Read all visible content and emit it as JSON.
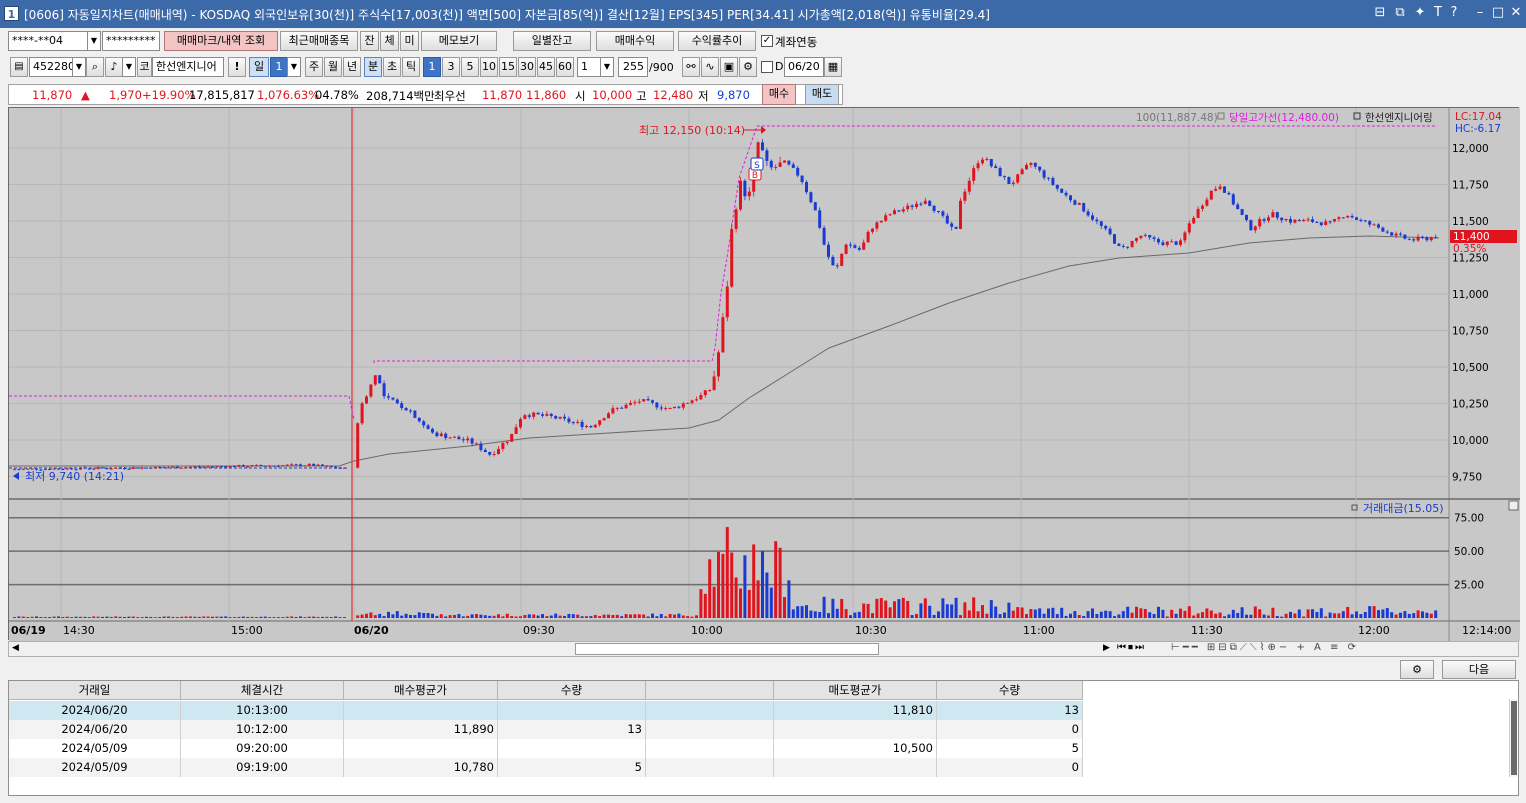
{
  "window": {
    "number": "1",
    "title": "[0606] 자동일지차트(매매내역) - KOSDAQ 외국인보유[30(천)] 주식수[17,003(천)] 액면[500] 자본금[85(억)] 결산[12월] EPS[345] PER[34.41] 시가총액[2,018(억)] 유통비율[29.4]"
  },
  "toolbar1": {
    "account": "****-**04",
    "password": "*********",
    "btn_mark": "매매마크/내역 조회",
    "btn_recent": "최근매매종목",
    "btn_jan": "잔",
    "btn_che": "체",
    "btn_mi": "미",
    "btn_memo": "메모보기",
    "btn_daily": "일별잔고",
    "btn_profit": "매매수익",
    "btn_trend": "수익률추이",
    "link_label": "계좌연동"
  },
  "toolbar2": {
    "code": "452280",
    "market_tag": "코",
    "stock_name": "한선엔지니어",
    "excl": "!",
    "period_day": "일",
    "period_num": "1",
    "week": "주",
    "month": "월",
    "year": "년",
    "min": "분",
    "sec": "초",
    "tick": "틱",
    "intervals": [
      "1",
      "3",
      "5",
      "10",
      "15",
      "30",
      "45",
      "60"
    ],
    "interval_value": "1",
    "count": "255",
    "count_total": "/900",
    "d_label": "D",
    "date": "06/20"
  },
  "quote": {
    "price": "11,870",
    "arrow": "▲",
    "change": "1,970",
    "rate": "+19.90%",
    "volume": "17,815,817",
    "vol_rate": "1,076.63%",
    "turnover": "04.78%",
    "amount": "208,714백만",
    "hoga_label": "최우선",
    "ask": "11,870",
    "bid": "11,860",
    "open_label": "시",
    "open": "10,000",
    "high_label": "고",
    "high": "12,480",
    "low_label": "저",
    "low": "9,870",
    "buy": "매수",
    "sell": "매도"
  },
  "chart": {
    "legend_ma": "100(11,887.48)",
    "legend_upper": "당일고가선(12,480.00)",
    "legend_name": "한선엔지니어링",
    "lc": "LC:17.04",
    "hc": "HC:-6.17",
    "high_note": "최고 12,150 (10:14)",
    "low_note": "최저 9,740 (14:21)",
    "price_tag": "11,400",
    "rate_tag": "0.35%",
    "y_ticks": [
      "12,000",
      "11,750",
      "11,500",
      "11,250",
      "11,000",
      "10,750",
      "10,500",
      "10,250",
      "10,000",
      "9,750"
    ],
    "vol_legend": "거래대금(15.05)",
    "vol_ticks": [
      "75.00",
      "50.00",
      "25.00"
    ],
    "x_labels": [
      "06/19",
      "14:30",
      "15:00",
      "06/20",
      "09:30",
      "10:00",
      "10:30",
      "11:00",
      "11:30",
      "12:00"
    ],
    "x_end": "12:14:00",
    "buy_mark": "B",
    "sell_mark": "S"
  },
  "chart_data": {
    "type": "candlestick",
    "y_range": [
      9700,
      12250
    ],
    "volume_range": [
      0,
      80
    ],
    "ma_label": "100",
    "high_line": 12480,
    "prev_upper_line": 10300
  },
  "bottom": {
    "next_btn": "다음"
  },
  "table": {
    "headers": [
      "거래일",
      "체결시간",
      "매수평균가",
      "수량",
      "",
      "매도평균가",
      "수량"
    ],
    "rows": [
      [
        "2024/06/20",
        "10:13:00",
        "",
        "",
        "",
        "11,810",
        "13"
      ],
      [
        "2024/06/20",
        "10:12:00",
        "11,890",
        "13",
        "",
        "",
        "0"
      ],
      [
        "2024/05/09",
        "09:20:00",
        "",
        "",
        "",
        "10,500",
        "5"
      ],
      [
        "2024/05/09",
        "09:19:00",
        "10,780",
        "5",
        "",
        "",
        "0"
      ]
    ]
  }
}
